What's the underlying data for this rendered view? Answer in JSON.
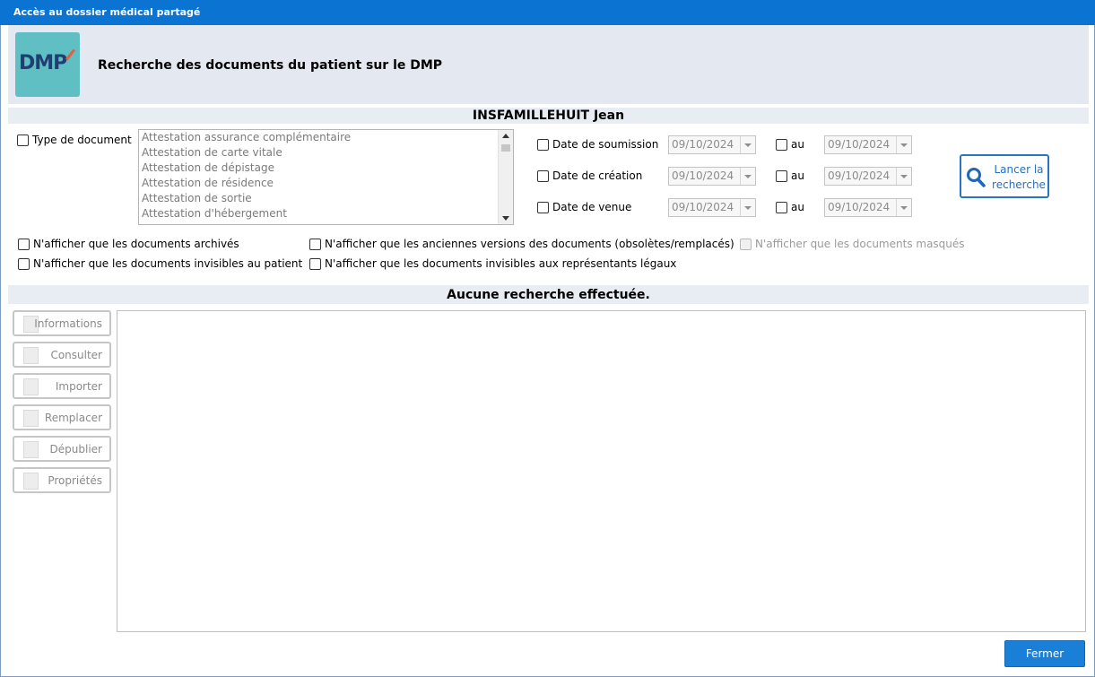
{
  "window": {
    "title": "Accès au dossier médical partagé"
  },
  "header": {
    "logo_text": "DMP",
    "title": "Recherche des documents du patient sur le DMP"
  },
  "patient": {
    "name": "INSFAMILLEHUIT Jean"
  },
  "filters": {
    "doc_type_label": "Type de document",
    "doc_types": [
      "Attestation assurance complémentaire",
      "Attestation de carte vitale",
      "Attestation de dépistage",
      "Attestation de résidence",
      "Attestation de sortie",
      "Attestation d'hébergement"
    ],
    "dates": [
      {
        "label": "Date de soumission",
        "from": "09/10/2024",
        "to_label": "au",
        "to": "09/10/2024"
      },
      {
        "label": "Date de création",
        "from": "09/10/2024",
        "to_label": "au",
        "to": "09/10/2024"
      },
      {
        "label": "Date de venue",
        "from": "09/10/2024",
        "to_label": "au",
        "to": "09/10/2024"
      }
    ],
    "search_button": {
      "line1": "Lancer la",
      "line2": "recherche"
    },
    "options": {
      "archived": "N'afficher que les documents archivés",
      "old_versions": "N'afficher que les anciennes versions des documents (obsolètes/remplacés)",
      "masked": "N'afficher que les documents masqués",
      "invisible_patient": "N'afficher que les documents invisibles au patient",
      "invisible_legal": "N'afficher que les documents invisibles aux représentants légaux"
    }
  },
  "results": {
    "status": "Aucune recherche effectuée."
  },
  "actions": {
    "informations": "Informations",
    "consulter": "Consulter",
    "importer": "Importer",
    "remplacer": "Remplacer",
    "depublier": "Dépublier",
    "proprietes": "Propriétés"
  },
  "footer": {
    "close": "Fermer"
  },
  "colors": {
    "titlebar": "#0b73d1",
    "accent": "#2a74c8",
    "primary_button": "#1a7fd6",
    "panel_bg": "#e3e8f1"
  }
}
